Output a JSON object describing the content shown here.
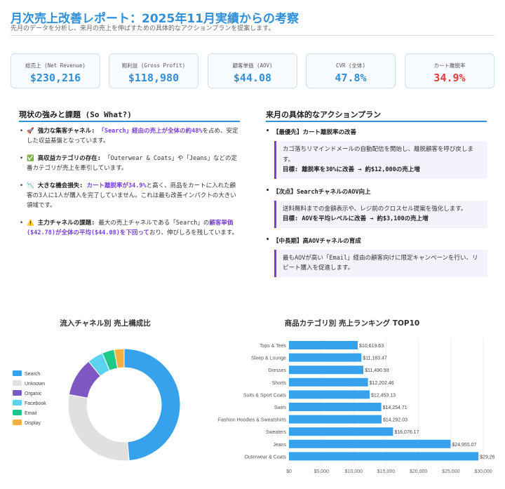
{
  "header": {
    "title": "月次売上改善レポート：2025年11月実績からの考察",
    "subtitle": "先月のデータを分析し、来月の売上を伸ばすための具体的なアクションプランを提案します。"
  },
  "kpis": [
    {
      "label": "総売上 (Net Revenue)",
      "value": "$230,216"
    },
    {
      "label": "粗利益 (Gross Profit)",
      "value": "$118,980"
    },
    {
      "label": "顧客単価 (AOV)",
      "value": "$44.08"
    },
    {
      "label": "CVR (全体)",
      "value": "47.8%"
    },
    {
      "label": "カート離脱率",
      "value": "34.9%"
    }
  ],
  "strengths": {
    "title": "現状の強みと課題 (So What?)",
    "items": [
      {
        "icon": "🚀",
        "head": "強力な集客チャネル:",
        "pre": " ",
        "highlight": "「Search」経由の売上が全体の約48%",
        "post": "を占め、安定した収益基盤となっています。"
      },
      {
        "icon": "✅",
        "head": "高収益カテゴリの存在:",
        "pre": " 「Outerwear & Coats」や「Jeans」などの定番カテゴリが売上を牽引しています。",
        "highlight": "",
        "post": ""
      },
      {
        "icon": "📉",
        "head": "大きな機会損失:",
        "pre": " ",
        "highlight": "カート離脱率が34.9%",
        "post": "と高く、商品をカートに入れた顧客の3人に1人が購入を完了していません。これは最も改善インパクトの大きい領域です。"
      },
      {
        "icon": "⚠️",
        "head": "主力チャネルの課題:",
        "pre": " 最大の売上チャネルである「Search」の",
        "highlight": "顧客単価($42.78)が全体の平均($44.08)を下回って",
        "post": "おり、伸びしろを残しています。"
      }
    ]
  },
  "actions": {
    "title": "来月の具体的なアクションプラン",
    "items": [
      {
        "head": "【最優先】カート離脱率の改善",
        "desc": "カゴ落ちリマインドメールの自動配信を開始し、離脱顧客を呼び戻します。",
        "goal": "目標: 離脱率を30%に改善 → 約$12,000の売上増"
      },
      {
        "head": "【次点】SearchチャネルのAOV向上",
        "desc": "送料無料までの金額表示や、レジ前のクロスセル提案を強化します。",
        "goal": "目標: AOVを平均レベルに改善 → 約$3,100の売上増"
      },
      {
        "head": "【中長期】高AOVチャネルの育成",
        "desc": "最もAOVが高い「Email」経由の顧客向けに限定キャンペーンを行い、リピート購入を促進します。",
        "goal": ""
      }
    ]
  },
  "chart_data": [
    {
      "type": "pie",
      "title": "流入チャネル別 売上構成比",
      "labels": [
        "Search",
        "Unknown",
        "Organic",
        "Facebook",
        "Email",
        "Display"
      ],
      "values": [
        48,
        29,
        11,
        4.5,
        3.5,
        2.8
      ],
      "colors": [
        "#36a2eb",
        "#e0e0e0",
        "#7e57c2",
        "#5bd3f0",
        "#1cc88a",
        "#f6b042"
      ],
      "legend": "left"
    },
    {
      "type": "bar",
      "orientation": "horizontal",
      "title": "商品カテゴリ別 売上ランキング TOP10",
      "categories": [
        "Tops & Tees",
        "Sleep & Lounge",
        "Dresses",
        "Shorts",
        "Suits & Sport Coats",
        "Swim",
        "Fashion Hoodies & Sweatshirts",
        "Sweaters",
        "Jeans",
        "Outerwear & Coats"
      ],
      "values": [
        10619.63,
        11183.47,
        11490.93,
        12202.46,
        12453.13,
        14254.71,
        14292.03,
        16076.17,
        24955.07,
        29260
      ],
      "value_labels": [
        "$10,619.63",
        "$11,183.47",
        "$11,490.93",
        "$12,202.46",
        "$12,453.13",
        "$14,254.71",
        "$14,292.03",
        "$16,076.17",
        "$24,955.07",
        "$29,26"
      ],
      "ticks": [
        "$0",
        "$5,000",
        "$10,000",
        "$15,000",
        "$20,000",
        "$25,000",
        "$30,000"
      ],
      "xlim": [
        0,
        30000
      ],
      "color": "#36a2eb"
    }
  ]
}
